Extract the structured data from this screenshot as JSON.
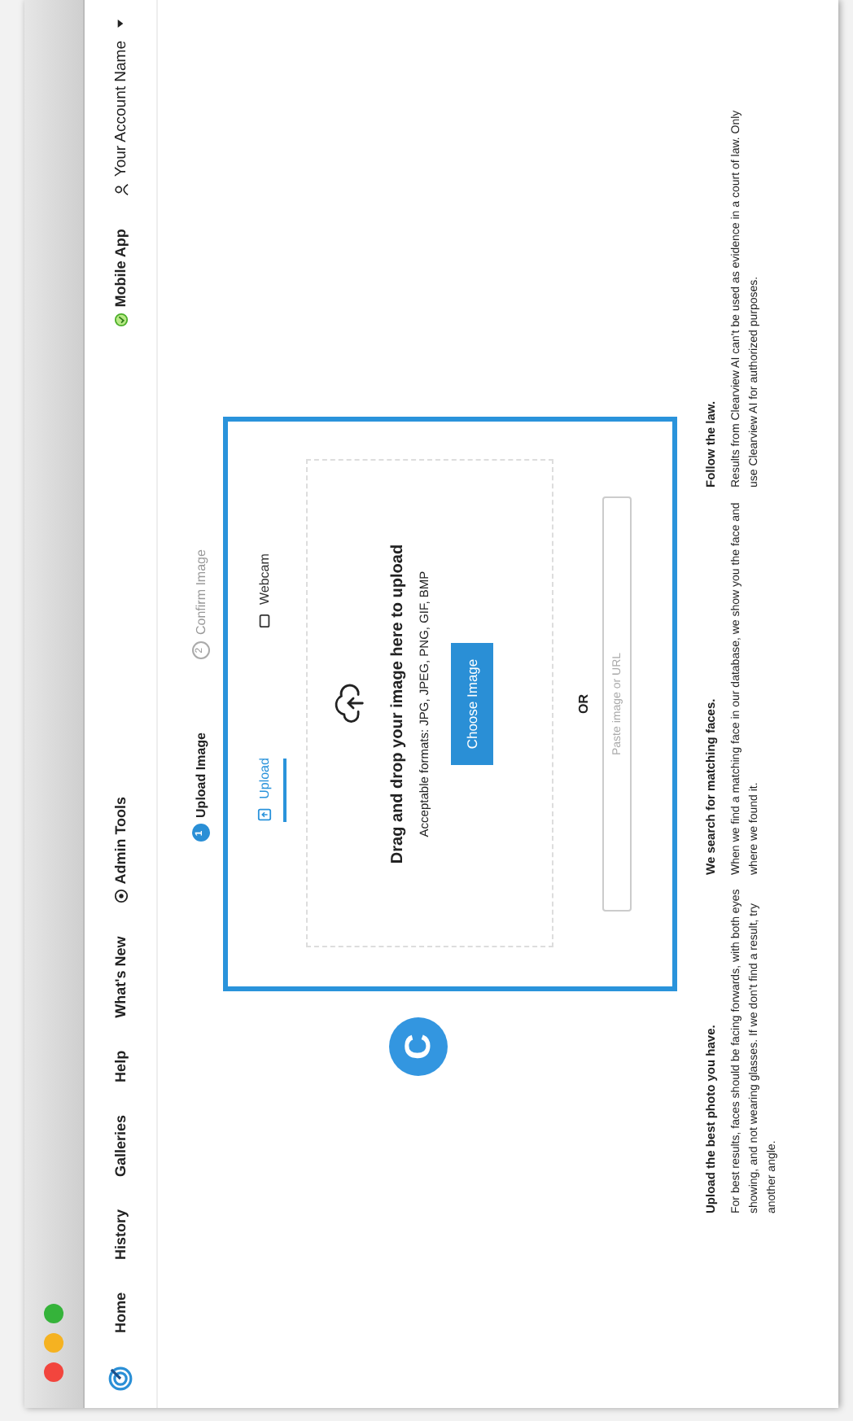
{
  "nav": {
    "items": [
      {
        "label": "Home"
      },
      {
        "label": "History"
      },
      {
        "label": "Galleries"
      },
      {
        "label": "Help"
      },
      {
        "label": "What's New"
      },
      {
        "label": "Admin Tools",
        "kind": "admin"
      }
    ],
    "mobile_app": "Mobile App",
    "account": "Your Account Name"
  },
  "steps": [
    {
      "number": "1",
      "label": "Upload Image",
      "selected": true
    },
    {
      "number": "2",
      "label": "Confirm Image",
      "selected": false
    }
  ],
  "upload": {
    "tabs": [
      {
        "label": "Upload",
        "kind": "file",
        "selected": true
      },
      {
        "label": "Webcam",
        "kind": "camera",
        "selected": false
      }
    ],
    "drop_title": "Drag and drop your image here to upload",
    "formats": "Acceptable formats: JPG, JPEG, PNG, GIF, BMP",
    "button": "Choose Image",
    "separator": "OR",
    "url_field": {
      "placeholder": "Paste image or URL"
    }
  },
  "badge": "C",
  "tips": [
    {
      "title": "Upload the best photo you have.",
      "text": "For best results, faces should be facing forwards, with both eyes showing, and not wearing glasses. If we don't find a result, try another angle."
    },
    {
      "title": "We search for matching faces.",
      "text": "When we find a matching face in our database, we show you the face and where we found it."
    },
    {
      "title": "Follow the law.",
      "text": "Results from Clearview AI can't be used as evidence in a court of law. Only use Clearview AI for authorized purposes."
    }
  ]
}
